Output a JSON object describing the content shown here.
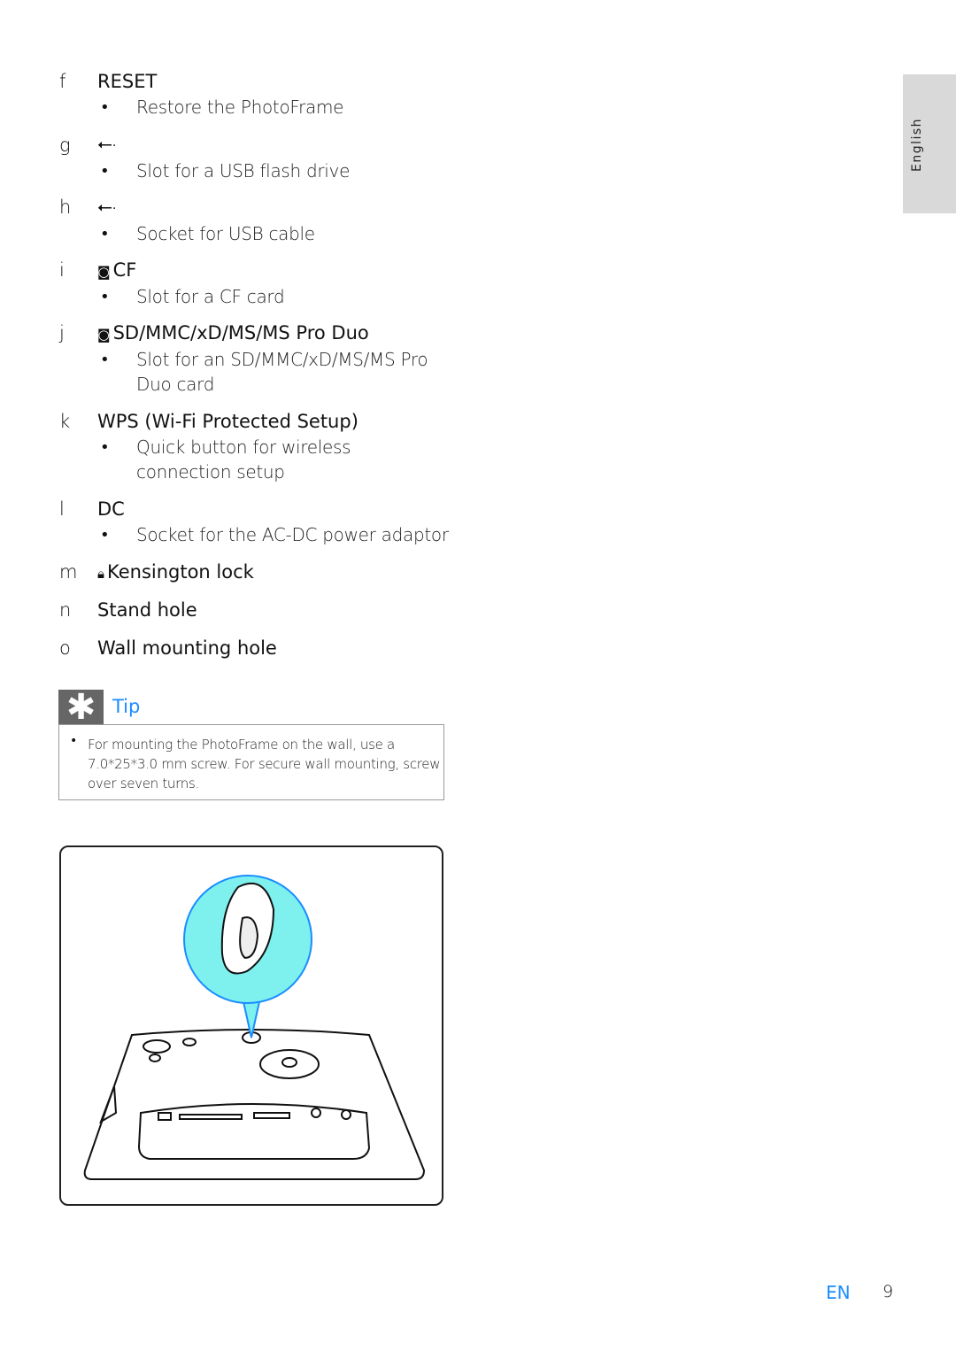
{
  "side_tab": "English",
  "items": [
    {
      "letter": "f",
      "title": "RESET",
      "icon": "",
      "bullet": "Restore the PhotoFrame"
    },
    {
      "letter": "g",
      "title": "",
      "icon": "usb-icon",
      "bullet": "Slot for a USB flash drive"
    },
    {
      "letter": "h",
      "title": "",
      "icon": "usb-icon",
      "bullet": "Socket for USB cable"
    },
    {
      "letter": "i",
      "title": "CF",
      "icon": "memory-card-icon",
      "bullet": "Slot for a CF card"
    },
    {
      "letter": "j",
      "title": "SD/MMC/xD/MS/MS Pro Duo",
      "icon": "memory-card-icon",
      "bullet": "Slot for an SD/MMC/xD/MS/MS Pro Duo card"
    },
    {
      "letter": "k",
      "title": "WPS (Wi-Fi Protected Setup)",
      "icon": "",
      "bullet": "Quick button for wireless connection setup"
    },
    {
      "letter": "l",
      "title": "DC",
      "icon": "",
      "bullet": "Socket for the AC-DC power adaptor"
    },
    {
      "letter": "m",
      "title": "Kensington lock",
      "icon": "lock-icon",
      "bullet": ""
    },
    {
      "letter": "n",
      "title": "Stand hole",
      "icon": "",
      "bullet": ""
    },
    {
      "letter": "o",
      "title": "Wall mounting hole",
      "icon": "",
      "bullet": ""
    }
  ],
  "tip": {
    "title": "Tip",
    "text": "For mounting the PhotoFrame on the wall, use a 7.0*25*3.0 mm screw. For secure wall mounting, screw over seven turns."
  },
  "footer": {
    "lang": "EN",
    "page": "9"
  }
}
